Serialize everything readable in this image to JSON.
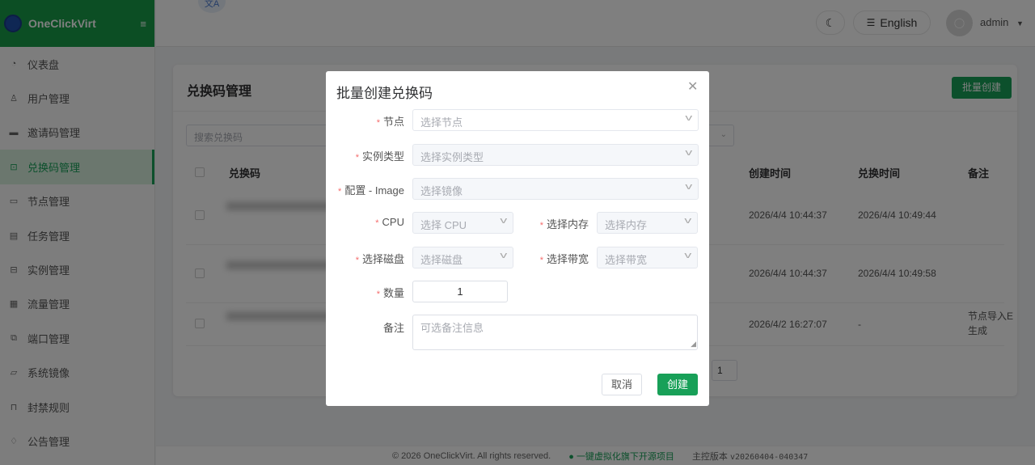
{
  "app": {
    "name": "OneClickVirt",
    "menu_icon": "hamburger-icon"
  },
  "sidebar": {
    "items": [
      {
        "label": "仪表盘",
        "icon": "dashboard-icon"
      },
      {
        "label": "用户管理",
        "icon": "user-icon"
      },
      {
        "label": "邀请码管理",
        "icon": "ticket-icon"
      },
      {
        "label": "兑换码管理",
        "icon": "redeem-icon",
        "active": true
      },
      {
        "label": "节点管理",
        "icon": "monitor-icon"
      },
      {
        "label": "任务管理",
        "icon": "task-icon"
      },
      {
        "label": "实例管理",
        "icon": "instance-icon"
      },
      {
        "label": "流量管理",
        "icon": "traffic-icon"
      },
      {
        "label": "端口管理",
        "icon": "port-icon"
      },
      {
        "label": "系统镜像",
        "icon": "folder-icon"
      },
      {
        "label": "封禁规则",
        "icon": "lock-icon"
      },
      {
        "label": "公告管理",
        "icon": "bell-icon"
      }
    ]
  },
  "header": {
    "language": "English",
    "user": "admin"
  },
  "page": {
    "title": "兑换码管理",
    "batch_create": "批量创建",
    "search_placeholder": "搜索兑换码",
    "columns": {
      "code": "兑换码",
      "created": "创建时间",
      "redeemed": "兑换时间",
      "note": "备注"
    },
    "rows": [
      {
        "created": "2026/4/4 10:44:37",
        "redeemed": "2026/4/4 10:49:44",
        "note": ""
      },
      {
        "created": "2026/4/4 10:44:37",
        "redeemed": "2026/4/4 10:49:58",
        "note": ""
      },
      {
        "created": "2026/4/2 16:27:07",
        "redeemed": "-",
        "note": "节点导入E",
        "note2": "生成"
      }
    ],
    "current_page": "1"
  },
  "footer": {
    "copyright": "© 2026 OneClickVirt. All rights reserved.",
    "github_link": "一键虚拟化旗下开源项目",
    "version_label": "主控版本",
    "version": "v20260404-040347"
  },
  "dialog": {
    "title": "批量创建兑换码",
    "fields": {
      "node": {
        "label": "节点",
        "placeholder": "选择节点"
      },
      "type": {
        "label": "实例类型",
        "placeholder": "选择实例类型"
      },
      "image": {
        "label": "配置 - Image",
        "placeholder": "选择镜像"
      },
      "cpu": {
        "label": "CPU",
        "placeholder": "选择 CPU"
      },
      "memory": {
        "label": "选择内存",
        "placeholder": "选择内存"
      },
      "disk": {
        "label": "选择磁盘",
        "placeholder": "选择磁盘"
      },
      "bandwidth": {
        "label": "选择带宽",
        "placeholder": "选择带宽"
      },
      "quantity": {
        "label": "数量",
        "value": "1"
      },
      "note": {
        "label": "备注",
        "placeholder": "可选备注信息"
      }
    },
    "cancel": "取消",
    "create": "创建"
  },
  "colors": {
    "accent": "#18a058",
    "required": "#f56c6c"
  }
}
